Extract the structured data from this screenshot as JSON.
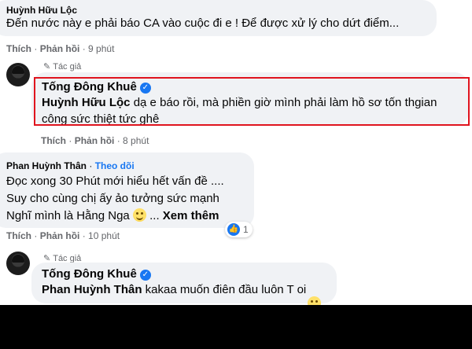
{
  "comments": {
    "c1": {
      "name": "Huỳnh Hữu Lộc",
      "text": "Đến nước này e phải báo CA vào cuộc đi e ! Để được xử lý cho dứt điểm...",
      "like_label": "Thích",
      "reply_label": "Phản hồi",
      "time": "9 phút"
    },
    "c2": {
      "author_tag": "Tác giả",
      "name": "Tống Đông Khuê",
      "mention": "Huỳnh Hữu Lộc",
      "text_line1": "dạ e báo rồi, mà phiền giờ mình phải làm hồ sơ tốn thgian",
      "text_line2": "công sức thiệt tức ghê",
      "like_label": "Thích",
      "reply_label": "Phản hồi",
      "time": "8 phút"
    },
    "c3": {
      "name": "Phan Huỳnh Thân",
      "follow_label": "Theo dõi",
      "line1": "Đọc xong 30 Phút mới hiểu hết vấn đề ....",
      "line2": "Suy cho cùng chị ấy ảo tưởng sức mạnh",
      "line3": "Nghĩ mình là Hằng Nga",
      "ellipsis": "...",
      "see_more": "Xem thêm",
      "like_label": "Thích",
      "reply_label": "Phản hồi",
      "time": "10 phút",
      "reaction_count": "1"
    },
    "c4": {
      "author_tag": "Tác giả",
      "name": "Tống Đông Khuê",
      "mention": "Phan Huỳnh Thân",
      "text": "kakaa muốn điên đầu luôn T oi"
    }
  },
  "icons": {
    "verified": "verified-badge-icon",
    "author": "pencil-icon",
    "like_reaction": "like-reaction-icon",
    "grin": "grin-emoji-icon",
    "laugh": "laugh-emoji-icon"
  },
  "colors": {
    "bubble": "#f0f2f5",
    "highlight_box": "#e0141e",
    "link_blue": "#1877f2",
    "meta_gray": "#65676b"
  }
}
